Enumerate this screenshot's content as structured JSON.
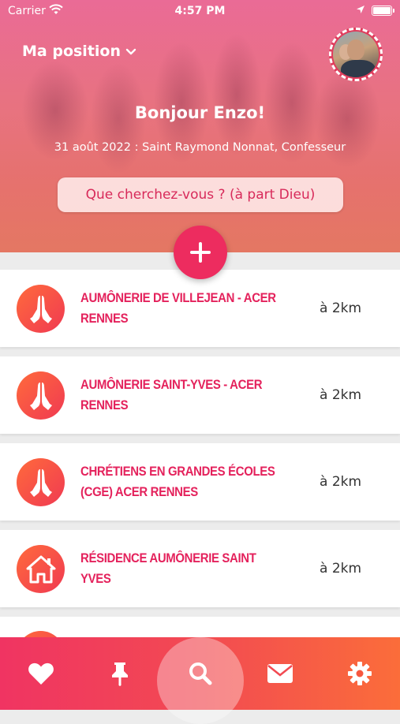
{
  "status_bar": {
    "carrier": "Carrier",
    "time": "4:57 PM"
  },
  "header": {
    "position_label": "Ma position",
    "greeting": "Bonjour Enzo!",
    "date_line": "31 août 2022 : Saint Raymond Nonnat, Confesseur",
    "search_placeholder": "Que cherchez-vous ? (à part Dieu)"
  },
  "list": {
    "items": [
      {
        "icon": "praying-hands-icon",
        "title": "AUMÔNERIE DE VILLEJEAN - ACER RENNES",
        "distance": "à 2km"
      },
      {
        "icon": "praying-hands-icon",
        "title": "AUMÔNERIE SAINT-YVES - ACER RENNES",
        "distance": "à 2km"
      },
      {
        "icon": "praying-hands-icon",
        "title": "CHRÉTIENS EN GRANDES ÉCOLES (CGE) ACER RENNES",
        "distance": "à 2km"
      },
      {
        "icon": "house-icon",
        "title": "RÉSIDENCE AUMÔNERIE SAINT YVES",
        "distance": "à 2km"
      }
    ]
  },
  "tabbar": {
    "tabs": [
      {
        "icon": "heart-icon"
      },
      {
        "icon": "pin-icon"
      },
      {
        "icon": "search-icon",
        "active": true
      },
      {
        "icon": "mail-icon"
      },
      {
        "icon": "gear-icon"
      }
    ]
  },
  "colors": {
    "accent": "#e4225c",
    "add_button": "#ed2c5f",
    "icon_gradient_start": "#ff6a3c",
    "icon_gradient_end": "#f03a52",
    "tabbar_start": "#f03462",
    "tabbar_end": "#fb6d3a"
  }
}
